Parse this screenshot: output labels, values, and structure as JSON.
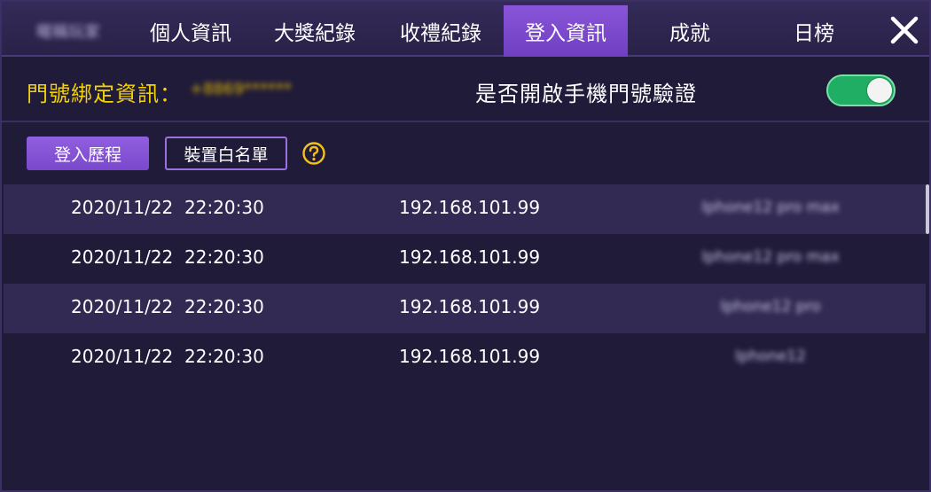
{
  "tabs": [
    {
      "label": "暱稱玩家",
      "blurred": true
    },
    {
      "label": "個人資訊"
    },
    {
      "label": "大獎紀錄"
    },
    {
      "label": "收禮紀錄"
    },
    {
      "label": "登入資訊",
      "active": true
    },
    {
      "label": "成就"
    },
    {
      "label": "日榜"
    }
  ],
  "binding": {
    "label": "門號綁定資訊：",
    "value": "+8869******",
    "verify_label": "是否開啟手機門號驗證",
    "verify_enabled": true
  },
  "subtabs": {
    "history": "登入歷程",
    "whitelist": "裝置白名單"
  },
  "rows": [
    {
      "date": "2020/11/22",
      "time": "22:20:30",
      "ip": "192.168.101.99",
      "device": "Iphone12 pro max"
    },
    {
      "date": "2020/11/22",
      "time": "22:20:30",
      "ip": "192.168.101.99",
      "device": "Iphone12 pro max"
    },
    {
      "date": "2020/11/22",
      "time": "22:20:30",
      "ip": "192.168.101.99",
      "device": "Iphone12 pro"
    },
    {
      "date": "2020/11/22",
      "time": "22:20:30",
      "ip": "192.168.101.99",
      "device": "Iphone12"
    }
  ],
  "colors": {
    "accent": "#7a48cc",
    "label_yellow": "#f5d300",
    "toggle_on": "#1fae63"
  }
}
